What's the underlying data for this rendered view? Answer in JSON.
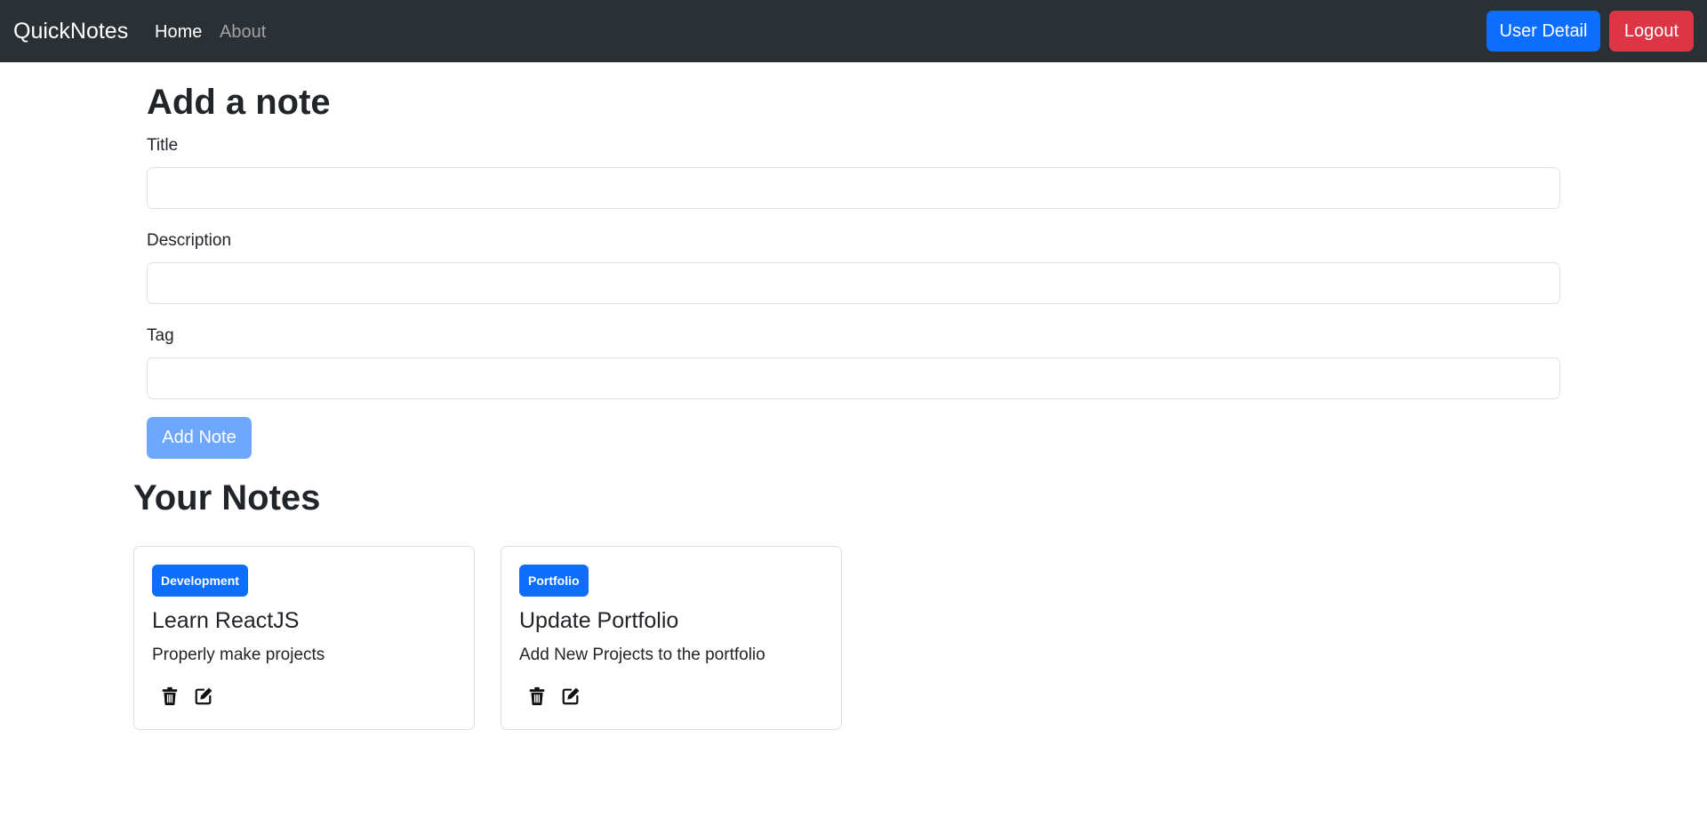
{
  "navbar": {
    "brand": "QuickNotes",
    "links": [
      {
        "label": "Home",
        "active": true
      },
      {
        "label": "About",
        "active": false
      }
    ],
    "user_detail_label": "User Detail",
    "logout_label": "Logout"
  },
  "form": {
    "heading": "Add a note",
    "title_label": "Title",
    "title_value": "",
    "description_label": "Description",
    "description_value": "",
    "tag_label": "Tag",
    "tag_value": "",
    "submit_label": "Add Note"
  },
  "notes": {
    "heading": "Your Notes",
    "items": [
      {
        "tag": "Development",
        "title": "Learn ReactJS",
        "description": "Properly make projects"
      },
      {
        "tag": "Portfolio",
        "title": "Update Portfolio",
        "description": "Add New Projects to the portfolio"
      }
    ],
    "delete_icon": "trash-icon",
    "edit_icon": "edit-icon"
  },
  "colors": {
    "navbar_bg": "#2b3035",
    "primary": "#0d6efd",
    "danger": "#dc3545",
    "primary_disabled": "#6ea8fe"
  }
}
